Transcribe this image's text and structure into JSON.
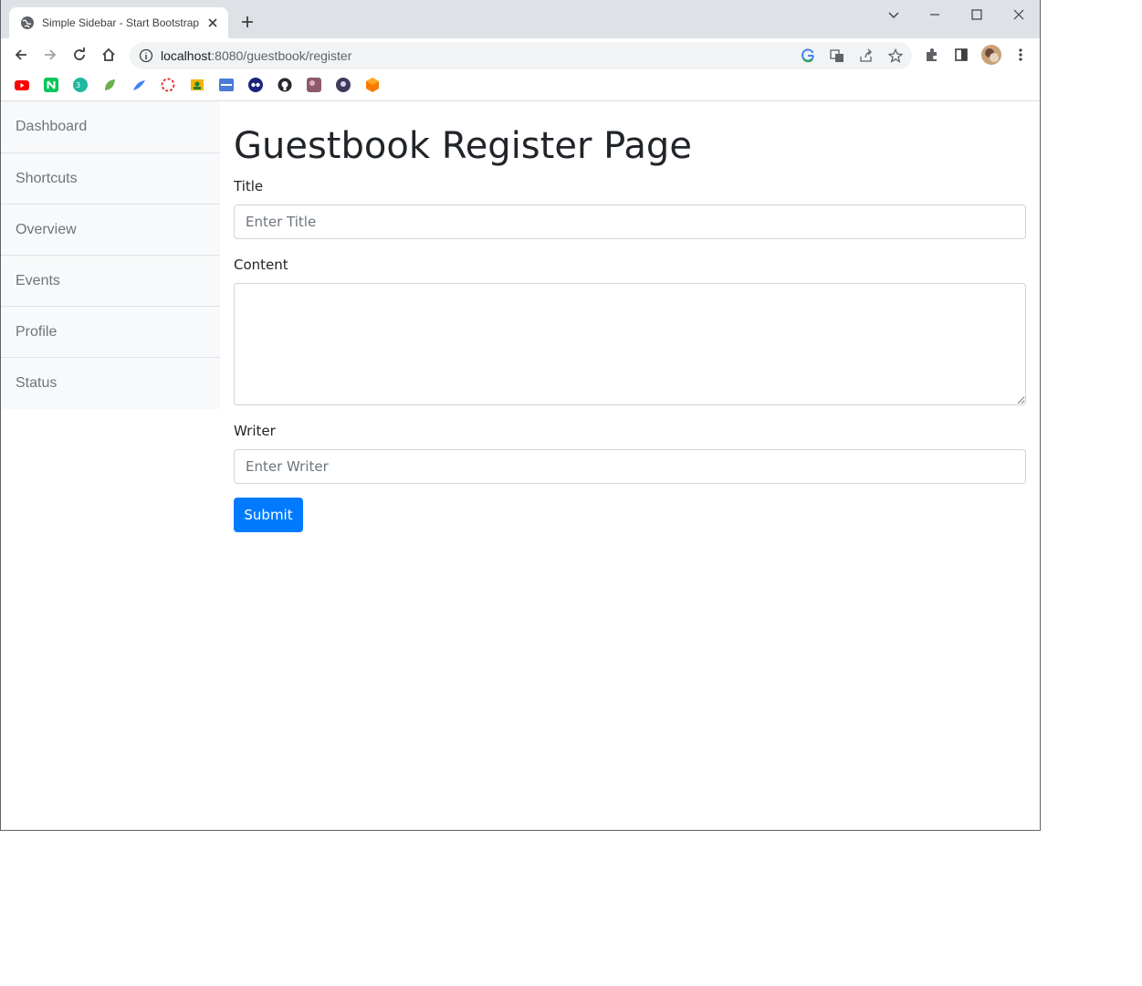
{
  "browser": {
    "tab_title": "Simple Sidebar - Start Bootstrap",
    "url_host": "localhost",
    "url_rest": ":8080/guestbook/register"
  },
  "sidebar": {
    "items": [
      {
        "label": "Dashboard"
      },
      {
        "label": "Shortcuts"
      },
      {
        "label": "Overview"
      },
      {
        "label": "Events"
      },
      {
        "label": "Profile"
      },
      {
        "label": "Status"
      }
    ]
  },
  "form": {
    "heading": "Guestbook Register Page",
    "title_label": "Title",
    "title_placeholder": "Enter Title",
    "content_label": "Content",
    "writer_label": "Writer",
    "writer_placeholder": "Enter Writer",
    "submit_label": "Submit"
  },
  "colors": {
    "primary": "#007bff",
    "sidebar_bg": "#f8f9fa",
    "text_muted": "#6c757d"
  },
  "bookmarks": [
    {
      "icon": "youtube-icon",
      "color": "#ff0000"
    },
    {
      "icon": "naver-icon",
      "color": "#03c75a"
    },
    {
      "icon": "green-circle-icon",
      "color": "#1fb8a0"
    },
    {
      "icon": "leaf-icon",
      "color": "#6ab04c"
    },
    {
      "icon": "blue-feather-icon",
      "color": "#3b82f6"
    },
    {
      "icon": "red-ring-icon",
      "color": "#e53935"
    },
    {
      "icon": "yellow-contact-icon",
      "color": "#f4b400"
    },
    {
      "icon": "blue-box-icon",
      "color": "#4a7bd8"
    },
    {
      "icon": "owl-icon",
      "color": "#1a237e"
    },
    {
      "icon": "github-icon",
      "color": "#24292e"
    },
    {
      "icon": "photo-icon",
      "color": "#8e5a6b"
    },
    {
      "icon": "dark-circle-icon",
      "color": "#3d3a5c"
    },
    {
      "icon": "orange-cube-icon",
      "color": "#f57c00"
    }
  ]
}
